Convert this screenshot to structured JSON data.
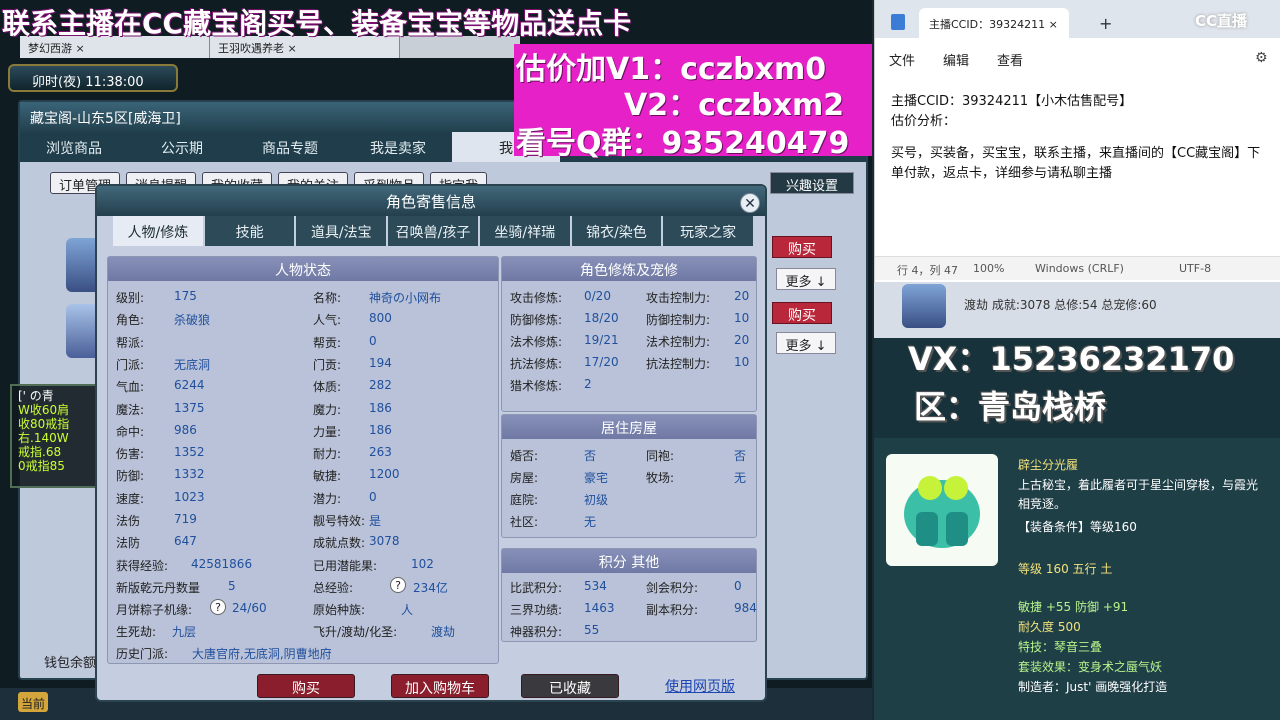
{
  "banner": {
    "line1": "联系主播在CC藏宝阁买号、装备宝宝等物品送点卡",
    "v1": "估价加V1：cczbxm0",
    "v2": "V2：cczbxm2",
    "qq": "看号Q群：935240479"
  },
  "browser_tabs": [
    "梦幻西游",
    "王羽吹遇养老"
  ],
  "game_time": "卯时(夜)  11:38:00",
  "window_title": "藏宝阁-山东5区[威海卫]",
  "nav_tabs": [
    "浏览商品",
    "公示期",
    "商品专题",
    "我是卖家",
    "我"
  ],
  "sub_tabs": [
    "订单管理",
    "消息提醒",
    "我的收藏",
    "我的关注",
    "采到物品",
    "指定我"
  ],
  "interest_button": "兴趣设置",
  "buy_label": "购买",
  "more_label": "更多 ↓",
  "chat_lines": [
    "[' の青",
    "W收60肩",
    "收80戒指",
    "右.140W",
    "戒指.68",
    "0戒指85"
  ],
  "purse_label": "钱包余额",
  "now_label": "当前",
  "dialog": {
    "title": "角色寄售信息",
    "tabs": [
      "人物/修炼",
      "技能",
      "道具/法宝",
      "召唤兽/孩子",
      "坐骑/祥瑞",
      "锦衣/染色",
      "玩家之家"
    ],
    "status_head": "人物状态",
    "left_col": [
      [
        "级别:",
        "175"
      ],
      [
        "角色:",
        "杀破狼"
      ],
      [
        "帮派:",
        ""
      ],
      [
        "门派:",
        "无底洞"
      ],
      [
        "气血:",
        "6244"
      ],
      [
        "魔法:",
        "1375"
      ],
      [
        "命中:",
        "986"
      ],
      [
        "伤害:",
        "1352"
      ],
      [
        "防御:",
        "1332"
      ],
      [
        "速度:",
        "1023"
      ],
      [
        "法伤",
        "719"
      ],
      [
        "法防",
        "647"
      ]
    ],
    "mid_col": [
      [
        "名称:",
        "神奇の小网布"
      ],
      [
        "人气:",
        "800"
      ],
      [
        "帮贡:",
        "0"
      ],
      [
        "门贡:",
        "194"
      ],
      [
        "体质:",
        "282"
      ],
      [
        "魔力:",
        "186"
      ],
      [
        "力量:",
        "186"
      ],
      [
        "耐力:",
        "263"
      ],
      [
        "敏捷:",
        "1200"
      ],
      [
        "潜力:",
        "0"
      ],
      [
        "靓号特效:",
        "是"
      ],
      [
        "成就点数:",
        "3078"
      ]
    ],
    "exp_label": "获得经验:",
    "exp_value": "42581866",
    "used_pot_label": "已用潜能果:",
    "used_pot_value": "102",
    "qianyuan_label": "新版乾元丹数量",
    "qianyuan_value": "5",
    "total_exp_label": "总经验:",
    "total_exp_value": "234亿",
    "yuebing_label": "月饼粽子机缘:",
    "yuebing_value": "24/60",
    "race_label": "原始种族:",
    "race_value": "人",
    "life_label": "生死劫:",
    "life_value": "九层",
    "fly_label": "飞升/渡劫/化圣:",
    "fly_value": "渡劫",
    "history_label": "历史门派:",
    "history_value": "大唐官府,无底洞,阴曹地府",
    "cultivation_head": "角色修炼及宠修",
    "cultivation": [
      [
        "攻击修炼:",
        "0/20",
        "攻击控制力:",
        "20"
      ],
      [
        "防御修炼:",
        "18/20",
        "防御控制力:",
        "10"
      ],
      [
        "法术修炼:",
        "19/21",
        "法术控制力:",
        "20"
      ],
      [
        "抗法修炼:",
        "17/20",
        "抗法控制力:",
        "10"
      ],
      [
        "猎术修炼:",
        "2",
        "",
        ""
      ]
    ],
    "house_head": "居住房屋",
    "house": [
      [
        "婚否:",
        "否",
        "同袍:",
        "否"
      ],
      [
        "房屋:",
        "豪宅",
        "牧场:",
        "无"
      ],
      [
        "庭院:",
        "初级",
        "",
        ""
      ],
      [
        "社区:",
        "无",
        "",
        ""
      ]
    ],
    "score_head": "积分 其他",
    "score": [
      [
        "比武积分:",
        "534",
        "剑会积分:",
        "0"
      ],
      [
        "三界功绩:",
        "1463",
        "副本积分:",
        "984"
      ],
      [
        "神器积分:",
        "55",
        "",
        ""
      ]
    ],
    "btn_buy": "购买",
    "btn_cart": "加入购物车",
    "btn_fav": "已收藏",
    "btn_web": "使用网页版"
  },
  "notepad": {
    "tab_title": "主播CCID：39324211",
    "menu": [
      "文件",
      "编辑",
      "查看"
    ],
    "line1": "主播CCID：39324211【小木估售配号】",
    "line2": "估价分析：",
    "line3": "买号，买装备，买宝宝，联系主播，来直播间的【CC藏宝阁】下单付款，返点卡，详细参与请私聊主播",
    "status_pos": "行 4，列 47",
    "status_zoom": "100%",
    "status_eol": "Windows (CRLF)",
    "status_enc": "UTF-8",
    "watermark": "CC直播"
  },
  "stream": {
    "char_line": "渡劫 成就:3078 总修:54 总宠修:60",
    "vx": "VX：15236232170",
    "zone": "区：青岛栈桥",
    "item_name": "辟尘分光履",
    "item_desc": "上古秘宝，着此履者可于星尘间穿梭，与霞光相竞逐。",
    "item_req": "【装备条件】等级160",
    "item_level": "等级 160 五行 土",
    "item_stats": "敏捷 +55 防御 +91",
    "item_dur": "耐久度 500",
    "item_skill": "特技：琴音三叠",
    "item_set": "套装效果：变身术之蜃气妖",
    "item_maker": "制造者：Just' 画晚强化打造"
  }
}
